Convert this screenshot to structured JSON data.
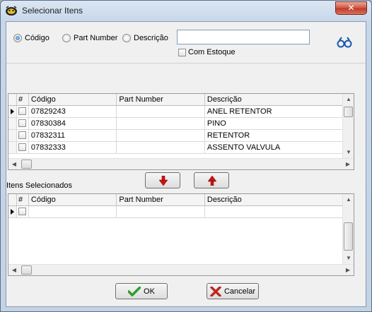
{
  "window": {
    "title": "Selecionar Itens",
    "close_glyph": "✕"
  },
  "search": {
    "options": [
      "Código",
      "Part Number",
      "Descrição"
    ],
    "selected_option": "Código",
    "input_value": "",
    "stock_label": "Com Estoque",
    "search_icon": "binoculars-icon"
  },
  "items_grid": {
    "columns": [
      "#",
      "Código",
      "Part Number",
      "Descrição"
    ],
    "rows": [
      {
        "code": "07829243",
        "part_number": "",
        "description": "ANEL RETENTOR"
      },
      {
        "code": "07830384",
        "part_number": "",
        "description": "PINO"
      },
      {
        "code": "07832311",
        "part_number": "",
        "description": "RETENTOR"
      },
      {
        "code": "07832333",
        "part_number": "",
        "description": "ASSENTO VALVULA"
      }
    ]
  },
  "selected_section": {
    "label": "Itens Selecionados",
    "columns": [
      "#",
      "Código",
      "Part Number",
      "Descrição"
    ]
  },
  "buttons": {
    "ok": "OK",
    "cancel": "Cancelar"
  },
  "colors": {
    "arrow_red": "#d01010",
    "ok_green": "#2f9e2f",
    "cancel_red": "#c0281c"
  }
}
